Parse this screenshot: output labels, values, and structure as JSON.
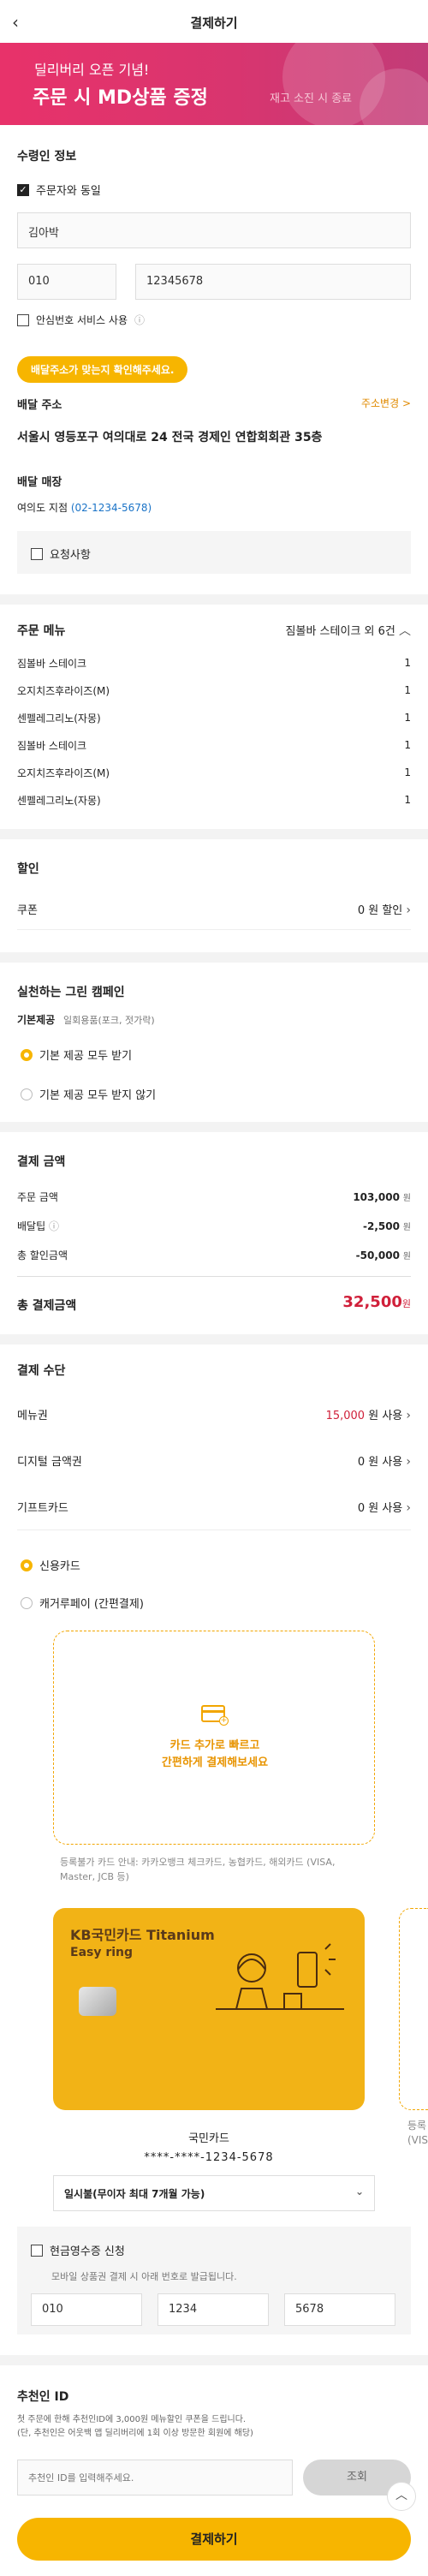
{
  "header": {
    "title": "결제하기",
    "back_icon": "‹"
  },
  "banner": {
    "line1": "딜리버리 오픈 기념!",
    "line2": "주문 시 MD상품 증정",
    "note": "재고 소진 시 종료"
  },
  "recipient": {
    "title": "수령인 정보",
    "same_as_orderer": "주문자와 동일",
    "name": "김아박",
    "phone_prefix": "010",
    "phone_number": "12345678",
    "safe_number": "안심번호 서비스 사용",
    "info_icon": "ⓘ"
  },
  "address": {
    "confirm_tag": "배달주소가 맞는지 확인해주세요.",
    "label": "배달 주소",
    "change": "주소변경 >",
    "value": "서울시 영등포구 여의대로 24 전국 경제인 연합회회관 35층",
    "store_label": "배달 매장",
    "store_name": "여의도 지점",
    "store_phone": "(02-1234-5678)",
    "request": "요청사항"
  },
  "order_menu": {
    "title": "주문 메뉴",
    "summary": "짐볼바 스테이크 외 6건",
    "items": [
      {
        "name": "짐볼바 스테이크",
        "qty": "1"
      },
      {
        "name": "오지치즈후라이즈(M)",
        "qty": "1"
      },
      {
        "name": "센펠레그리노(자몽)",
        "qty": "1"
      },
      {
        "name": "짐볼바 스테이크",
        "qty": "1"
      },
      {
        "name": "오지치즈후라이즈(M)",
        "qty": "1"
      },
      {
        "name": "센펠레그리노(자몽)",
        "qty": "1"
      }
    ]
  },
  "discount": {
    "title": "할인",
    "coupon_label": "쿠폰",
    "coupon_value": "0 원 할인"
  },
  "green": {
    "title": "실천하는 그린 캠페인",
    "basic_label": "기본제공",
    "basic_desc": "일회용품(포크, 젓가락)",
    "opt1": "기본 제공 모두 받기",
    "opt2": "기본 제공 모두 받지 않기"
  },
  "amount": {
    "title": "결제 금액",
    "rows": [
      {
        "label": "주문 금액",
        "value": "103,000",
        "unit": "원"
      },
      {
        "label": "배달팁",
        "value": "-2,500",
        "unit": "원"
      },
      {
        "label": "총 할인금액",
        "value": "-50,000",
        "unit": "원"
      }
    ],
    "total_label": "총 결제금액",
    "total_value": "32,500",
    "total_unit": "원"
  },
  "payment": {
    "title": "결제 수단",
    "voucher_label": "메뉴권",
    "voucher_amount": "15,000",
    "voucher_suffix": "원 사용",
    "digital_label": "디지털 금액권",
    "digital_value": "0 원 사용",
    "gift_label": "기프트카드",
    "gift_value": "0 원 사용",
    "credit": "신용카드",
    "easy_pay": "캐거루페이 (간편결제)",
    "add_card_line1": "카드 추가로 빠르고",
    "add_card_line2": "간편하게 결제해보세요",
    "notice": "등록불가 카드 안내: 카카오뱅크 체크카드, 농협카드, 해외카드 (VISA, Master, JCB 등)",
    "card_brand": "KB국민카드 Titanium",
    "card_sub": "Easy ring",
    "card_name": "국민카드",
    "card_number": "****-****-1234-5678",
    "peek_text1": "등록",
    "peek_text2": "(VIS",
    "installment": "일시불(무이자 최대 7개월 가능)"
  },
  "receipt": {
    "title": "현금영수증 신청",
    "desc": "모바일 상품권 결제 시 아래 번호로 발급됩니다.",
    "f1": "010",
    "f2": "1234",
    "f3": "5678"
  },
  "recommender": {
    "title": "추천인 ID",
    "desc1": "첫 주문에 한해 추천인ID에 3,000원 메뉴할인 쿠폰을 드립니다.",
    "desc2": "(단, 추천인은 어웃백 앱 딜리버리에 1회 이상 방문한 회원에 해당)",
    "placeholder": "추천인 ID를 입력해주세요.",
    "lookup": "조회"
  },
  "pay_button": "결제하기"
}
